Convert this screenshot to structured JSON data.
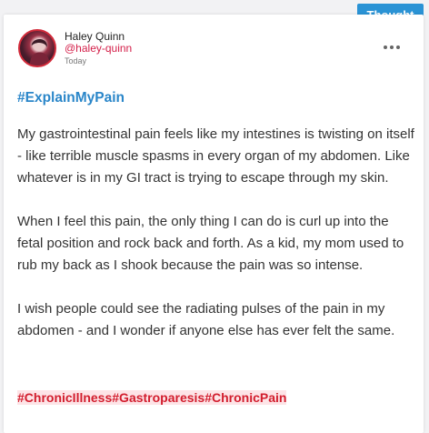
{
  "badge": "Thought",
  "author": {
    "name": "Haley Quinn",
    "handle": "@haley-quinn",
    "time": "Today"
  },
  "post": {
    "headline_tag": "#ExplainMyPain",
    "paragraphs": [
      "My gastrointestinal pain feels like my intestines is twisting on itself - like terrible muscle spasms in every organ of my abdomen. Like whatever is in my GI tract is trying to escape through my skin.",
      "When I feel this pain, the only thing I can do is curl up into the fetal position and rock back and forth. As a kid, my mom used to rub my back as I shook because the pain was so intense.",
      "I wish people could see the radiating pulses of the pain in my abdomen - and I wonder if anyone else has ever felt the same."
    ],
    "tags": [
      "#ChronicIllness",
      "#Gastroparesis",
      "#ChronicPain"
    ]
  },
  "icons": {
    "more": "more-horizontal-icon",
    "avatar": "user-avatar"
  },
  "colors": {
    "badge": "#2a93d5",
    "handle": "#d4204a",
    "headline_tag": "#2a86c9",
    "tags": "#d21d2d",
    "tag_highlight": "#fde4e7"
  }
}
